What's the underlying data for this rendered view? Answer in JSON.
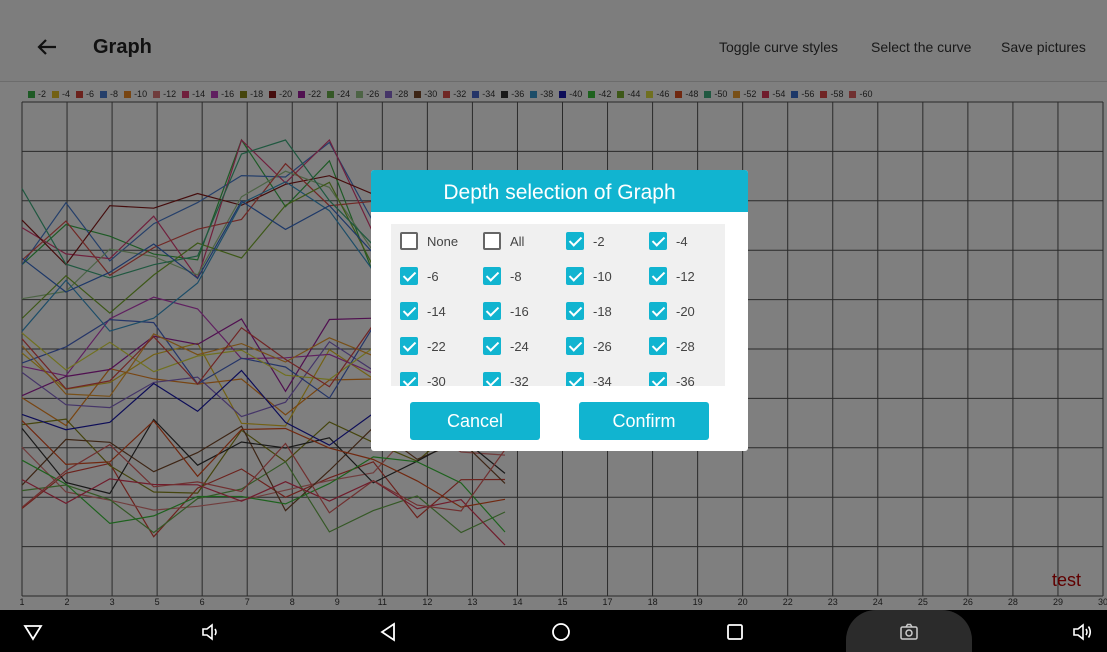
{
  "app_bar": {
    "title": "Graph",
    "menu": [
      "Toggle curve styles",
      "Select the curve",
      "Save pictures"
    ]
  },
  "legend": [
    {
      "label": "-2",
      "color": "#3cb44b"
    },
    {
      "label": "-4",
      "color": "#e6c229"
    },
    {
      "label": "-6",
      "color": "#d9453b"
    },
    {
      "label": "-8",
      "color": "#4a7fd4"
    },
    {
      "label": "-10",
      "color": "#f08a24"
    },
    {
      "label": "-12",
      "color": "#e07a7a"
    },
    {
      "label": "-14",
      "color": "#e0407a"
    },
    {
      "label": "-16",
      "color": "#c040c0"
    },
    {
      "label": "-18",
      "color": "#8a8a1a"
    },
    {
      "label": "-20",
      "color": "#8b1a1a"
    },
    {
      "label": "-22",
      "color": "#a020a0"
    },
    {
      "label": "-24",
      "color": "#6ab04c"
    },
    {
      "label": "-26",
      "color": "#9bc88a"
    },
    {
      "label": "-28",
      "color": "#8a6ad0"
    },
    {
      "label": "-30",
      "color": "#7a4a2a"
    },
    {
      "label": "-32",
      "color": "#e0504a"
    },
    {
      "label": "-34",
      "color": "#4a6ad0"
    },
    {
      "label": "-36",
      "color": "#333333"
    },
    {
      "label": "-38",
      "color": "#3a9ad0"
    },
    {
      "label": "-40",
      "color": "#1a1ab0"
    },
    {
      "label": "-42",
      "color": "#3cc43c"
    },
    {
      "label": "-44",
      "color": "#7ab030"
    },
    {
      "label": "-46",
      "color": "#e0e040"
    },
    {
      "label": "-48",
      "color": "#e05020"
    },
    {
      "label": "-50",
      "color": "#40b080"
    },
    {
      "label": "-52",
      "color": "#f0a030"
    },
    {
      "label": "-54",
      "color": "#e03a5a"
    },
    {
      "label": "-56",
      "color": "#3a70d0"
    },
    {
      "label": "-58",
      "color": "#e04a4a"
    },
    {
      "label": "-60",
      "color": "#e06060"
    }
  ],
  "x_axis": {
    "ticks": [
      "1",
      "2",
      "3",
      "5",
      "6",
      "7",
      "8",
      "9",
      "11",
      "12",
      "13",
      "14",
      "15",
      "17",
      "18",
      "19",
      "20",
      "22",
      "23",
      "24",
      "25",
      "26",
      "28",
      "29",
      "30"
    ]
  },
  "watermark": "test",
  "dialog": {
    "title": "Depth selection of Graph",
    "options": [
      {
        "label": "None",
        "checked": false
      },
      {
        "label": "All",
        "checked": false
      },
      {
        "label": "-2",
        "checked": true
      },
      {
        "label": "-4",
        "checked": true
      },
      {
        "label": "-6",
        "checked": true
      },
      {
        "label": "-8",
        "checked": true
      },
      {
        "label": "-10",
        "checked": true
      },
      {
        "label": "-12",
        "checked": true
      },
      {
        "label": "-14",
        "checked": true
      },
      {
        "label": "-16",
        "checked": true
      },
      {
        "label": "-18",
        "checked": true
      },
      {
        "label": "-20",
        "checked": true
      },
      {
        "label": "-22",
        "checked": true
      },
      {
        "label": "-24",
        "checked": true
      },
      {
        "label": "-26",
        "checked": true
      },
      {
        "label": "-28",
        "checked": true
      },
      {
        "label": "-30",
        "checked": true
      },
      {
        "label": "-32",
        "checked": true
      },
      {
        "label": "-34",
        "checked": true
      },
      {
        "label": "-36",
        "checked": true
      }
    ],
    "cancel_label": "Cancel",
    "confirm_label": "Confirm"
  },
  "colors": {
    "accent": "#11b4d0",
    "watermark": "#c00000",
    "nav_bar": "#000000"
  }
}
